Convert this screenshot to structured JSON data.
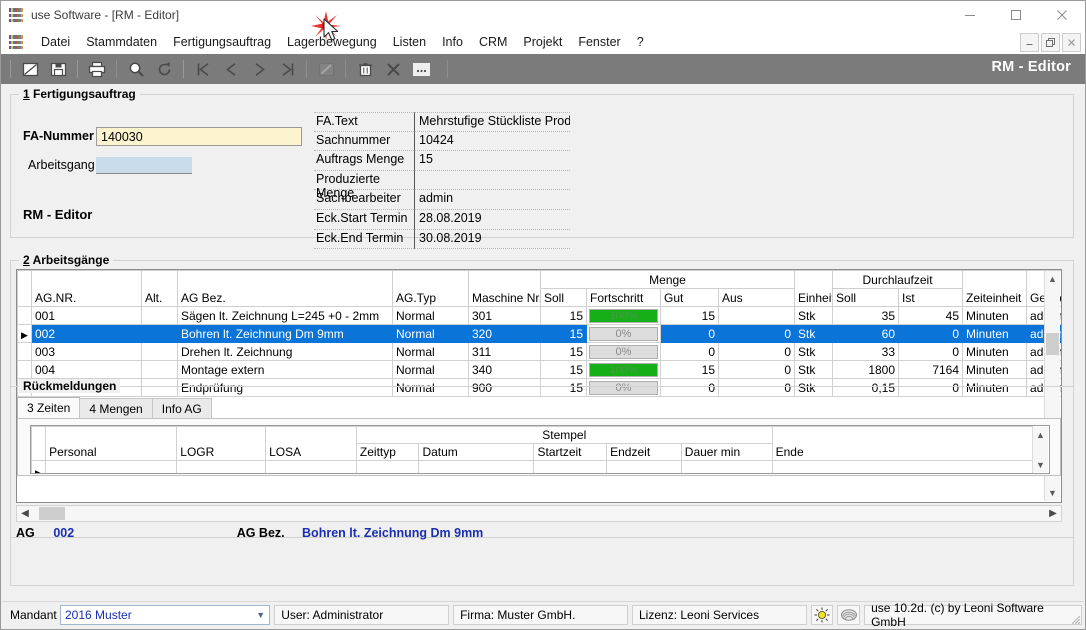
{
  "window": {
    "title": "use Software - [RM - Editor]",
    "controls": {
      "minimize": "minimize-icon",
      "maximize": "maximize-icon",
      "close": "close-icon"
    }
  },
  "menubar": {
    "items": [
      "Datei",
      "Stammdaten",
      "Fertigungsauftrag",
      "Lagerbewegung",
      "Listen",
      "Info",
      "CRM",
      "Projekt",
      "Fenster",
      "?"
    ],
    "mdi_controls": [
      "minimize",
      "restore",
      "close"
    ]
  },
  "toolbar": {
    "title": "RM - Editor",
    "buttons": [
      "edit-icon",
      "save-icon",
      "print-icon",
      "search-icon",
      "refresh-icon",
      "first-record-icon",
      "previous-record-icon",
      "next-record-icon",
      "last-record-icon",
      "pencil-icon",
      "delete-icon",
      "cancel-icon",
      "more-icon"
    ]
  },
  "section1": {
    "legend_num": "1",
    "legend": "Fertigungsauftrag",
    "fa_nummer_label": "FA-Nummer",
    "fa_nummer_value": "140030",
    "arbeitsgang_label": "Arbeitsgang",
    "arbeitsgang_value": "",
    "rm_editor_label": "RM - Editor",
    "details": [
      {
        "key": "FA.Text",
        "value": "Mehrstufige Stückliste Produkt"
      },
      {
        "key": "Sachnummer",
        "value": "10424"
      },
      {
        "key": "Auftrags Menge",
        "value": "15"
      },
      {
        "key": "Produzierte Menge",
        "value": ""
      },
      {
        "key": "Sachbearbeiter",
        "value": "admin"
      },
      {
        "key": "Eck.Start Termin",
        "value": "28.08.2019"
      },
      {
        "key": "Eck.End Termin",
        "value": "30.08.2019"
      }
    ]
  },
  "section2": {
    "legend_num": "2",
    "legend": "Arbeitsgänge",
    "group_headers": {
      "menge": "Menge",
      "durchlaufzeit": "Durchlaufzeit"
    },
    "columns": [
      "AG.NR.",
      "Alt.",
      "AG Bez.",
      "AG.Typ",
      "Maschine Nr.",
      "Soll",
      "Fortschritt",
      "Gut",
      "Aus",
      "Einheit",
      "Soll",
      "Ist",
      "Zeiteinheit",
      "Geändert von"
    ],
    "rows": [
      {
        "selected": false,
        "ag_nr": "001",
        "alt": "",
        "bez": "Sägen lt. Zeichnung L=245 +0 - 2mm",
        "typ": "Normal",
        "maschine": "301",
        "soll": "15",
        "fortschritt": 100,
        "fortschritt_label": "100%",
        "gut": "15",
        "aus": "",
        "einheit": "Stk",
        "dlz_soll": "35",
        "dlz_ist": "45",
        "zeiteinheit": "Minuten",
        "geaendert": "admin"
      },
      {
        "selected": true,
        "ag_nr": "002",
        "alt": "",
        "bez": "Bohren lt. Zeichnung Dm 9mm",
        "typ": "Normal",
        "maschine": "320",
        "soll": "15",
        "fortschritt": 0,
        "fortschritt_label": "0%",
        "gut": "0",
        "aus": "0",
        "einheit": "Stk",
        "dlz_soll": "60",
        "dlz_ist": "0",
        "zeiteinheit": "Minuten",
        "geaendert": "admin"
      },
      {
        "selected": false,
        "ag_nr": "003",
        "alt": "",
        "bez": "Drehen lt. Zeichnung",
        "typ": "Normal",
        "maschine": "311",
        "soll": "15",
        "fortschritt": 0,
        "fortschritt_label": "0%",
        "gut": "0",
        "aus": "0",
        "einheit": "Stk",
        "dlz_soll": "33",
        "dlz_ist": "0",
        "zeiteinheit": "Minuten",
        "geaendert": "admin"
      },
      {
        "selected": false,
        "ag_nr": "004",
        "alt": "",
        "bez": "Montage extern",
        "typ": "Normal",
        "maschine": "340",
        "soll": "15",
        "fortschritt": 100,
        "fortschritt_label": "100%",
        "gut": "15",
        "aus": "0",
        "einheit": "Stk",
        "dlz_soll": "1800",
        "dlz_ist": "7164",
        "zeiteinheit": "Minuten",
        "geaendert": "admin"
      },
      {
        "selected": false,
        "ag_nr": "900",
        "alt": "",
        "bez": "Endprüfung",
        "typ": "Normal",
        "maschine": "900",
        "soll": "15",
        "fortschritt": 0,
        "fortschritt_label": "0%",
        "gut": "0",
        "aus": "0",
        "einheit": "Stk",
        "dlz_soll": "0,15",
        "dlz_ist": "0",
        "zeiteinheit": "Minuten",
        "geaendert": "admin"
      }
    ],
    "summary": {
      "ag_label": "AG",
      "ag_value": "002",
      "bez_label": "AG Bez.",
      "bez_value": "Bohren lt. Zeichnung Dm 9mm"
    }
  },
  "section3": {
    "legend": "Rückmeldungen",
    "tabs": [
      {
        "label": "3 Zeiten",
        "active": true
      },
      {
        "label": "4 Mengen",
        "active": false
      },
      {
        "label": "Info AG",
        "active": false
      }
    ],
    "group_headers": {
      "stempel": "Stempel"
    },
    "columns": [
      "Personal",
      "LOGR",
      "LOSA",
      "Zeittyp",
      "Datum",
      "Startzeit",
      "Endzeit",
      "Dauer min",
      "Ende"
    ],
    "rows": [
      {
        "personal": "",
        "logr": "",
        "losa": "",
        "zeittyp": "",
        "datum": "",
        "startzeit": "",
        "endzeit": "",
        "dauer": "",
        "ende": ""
      }
    ]
  },
  "statusbar": {
    "mandant_label": "Mandant",
    "mandant_value": "2016 Muster",
    "user": "User: Administrator",
    "firma": "Firma: Muster GmbH.",
    "lizenz": "Lizenz: Leoni Services",
    "version": "use 10.2d. (c) by Leoni Software GmbH",
    "icons": [
      "sun-icon",
      "shell-icon"
    ]
  },
  "colors": {
    "toolbar_bg": "#7b7b7b",
    "selection": "#0a74d8",
    "progress_green": "#17af17",
    "input_yellow": "#fcf3cf",
    "input_blue": "#c9dceb",
    "link_blue": "#1a2fb0",
    "click_marker": "#e81010"
  }
}
